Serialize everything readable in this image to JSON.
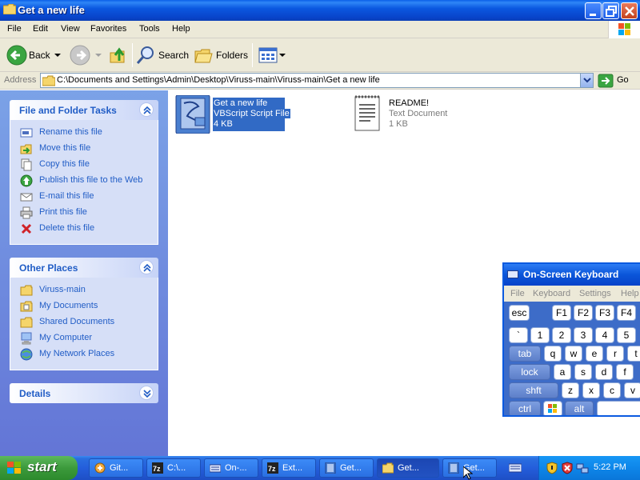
{
  "window": {
    "title": "Get a new life"
  },
  "menubar": {
    "items": [
      "File",
      "Edit",
      "View",
      "Favorites",
      "Tools",
      "Help"
    ]
  },
  "toolbar": {
    "back_label": "Back",
    "search_label": "Search",
    "folders_label": "Folders"
  },
  "address": {
    "label": "Address",
    "value": "C:\\Documents and Settings\\Admin\\Desktop\\Viruss-main\\Viruss-main\\Get a new life",
    "go_label": "Go"
  },
  "tasks": {
    "file_folder": {
      "title": "File and Folder Tasks",
      "items": [
        {
          "label": "Rename this file",
          "icon": "rename-icon"
        },
        {
          "label": "Move this file",
          "icon": "move-icon"
        },
        {
          "label": "Copy this file",
          "icon": "copy-icon"
        },
        {
          "label": "Publish this file to the Web",
          "icon": "publish-web-icon"
        },
        {
          "label": "E-mail this file",
          "icon": "email-icon"
        },
        {
          "label": "Print this file",
          "icon": "print-icon"
        },
        {
          "label": "Delete this file",
          "icon": "delete-icon"
        }
      ]
    },
    "other_places": {
      "title": "Other Places",
      "items": [
        {
          "label": "Viruss-main",
          "icon": "folder-icon"
        },
        {
          "label": "My Documents",
          "icon": "my-documents-icon"
        },
        {
          "label": "Shared Documents",
          "icon": "folder-icon"
        },
        {
          "label": "My Computer",
          "icon": "my-computer-icon"
        },
        {
          "label": "My Network Places",
          "icon": "network-places-icon"
        }
      ]
    },
    "details": {
      "title": "Details"
    }
  },
  "files": [
    {
      "name": "Get a new life",
      "type": "VBScript Script File",
      "size": "4 KB",
      "icon": "vbscript-file-icon",
      "selected": true
    },
    {
      "name": "README!",
      "type": "Text Document",
      "size": "1 KB",
      "icon": "text-document-icon",
      "selected": false
    }
  ],
  "osk": {
    "title": "On-Screen Keyboard",
    "menu": [
      "File",
      "Keyboard",
      "Settings",
      "Help"
    ],
    "row1": [
      "esc",
      "F1",
      "F2",
      "F3",
      "F4"
    ],
    "row2": [
      "`",
      "1",
      "2",
      "3",
      "4",
      "5"
    ],
    "row3": [
      "tab",
      "q",
      "w",
      "e",
      "r",
      "t"
    ],
    "row4": [
      "lock",
      "a",
      "s",
      "d",
      "f"
    ],
    "row5": [
      "shft",
      "z",
      "x",
      "c",
      "v"
    ],
    "row6": [
      "ctrl",
      "alt"
    ]
  },
  "taskbar": {
    "start_label": "start",
    "tasks": [
      {
        "label": "Git...",
        "icon": "git-icon",
        "active": false
      },
      {
        "label": "C:\\...",
        "icon": "7zip-icon",
        "active": false
      },
      {
        "label": "On-...",
        "icon": "keyboard-icon",
        "active": false
      },
      {
        "label": "Ext...",
        "icon": "7zip-icon",
        "active": false
      },
      {
        "label": "Get...",
        "icon": "vbscript-file-icon",
        "active": false
      },
      {
        "label": "Get...",
        "icon": "folder-icon",
        "active": true
      },
      {
        "label": "Get...",
        "icon": "vbscript-file-icon",
        "active": false
      }
    ],
    "clock": "5:22 PM"
  }
}
